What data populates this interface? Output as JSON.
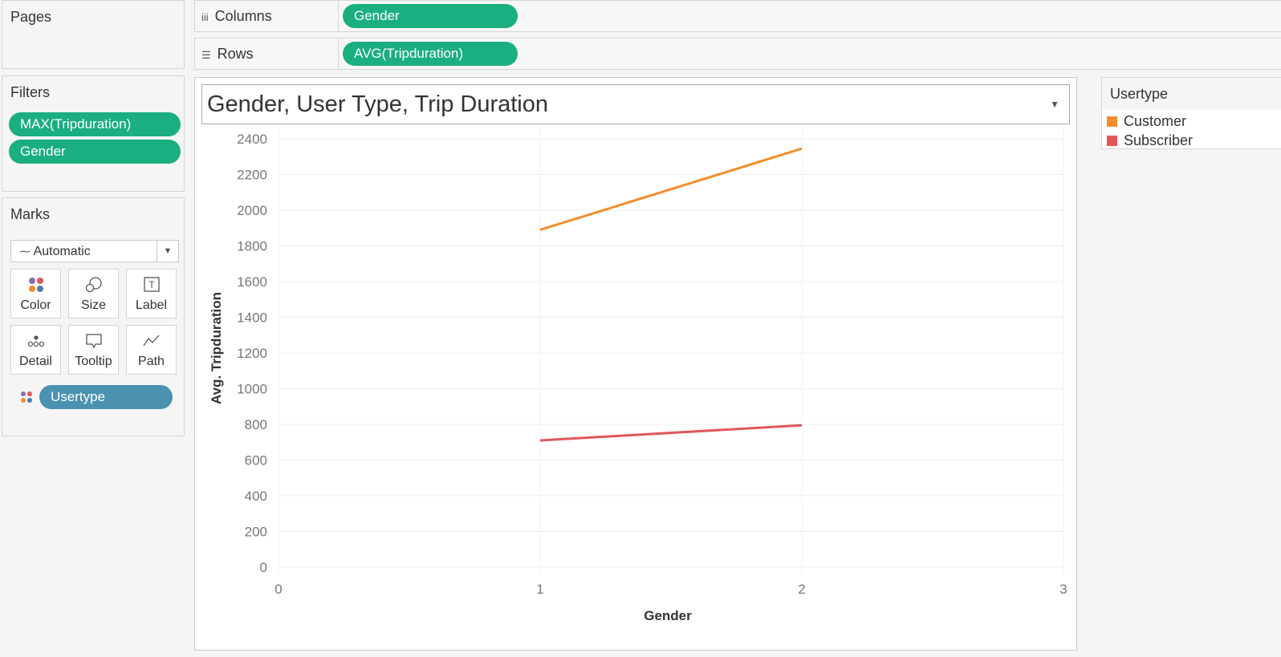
{
  "pages": {
    "title": "Pages"
  },
  "shelves": {
    "columns": {
      "label": "Columns",
      "pill": "Gender"
    },
    "rows": {
      "label": "Rows",
      "pill": "AVG(Tripduration)"
    }
  },
  "filters": {
    "title": "Filters",
    "pills": [
      "MAX(Tripduration)",
      "Gender"
    ]
  },
  "marks": {
    "title": "Marks",
    "type": "Automatic",
    "cards": {
      "color": "Color",
      "size": "Size",
      "label": "Label",
      "detail": "Detail",
      "tooltip": "Tooltip",
      "path": "Path"
    },
    "color_pill": "Usertype"
  },
  "viz": {
    "title": "Gender, User Type, Trip Duration"
  },
  "legend": {
    "title": "Usertype",
    "items": [
      {
        "label": "Customer",
        "color": "#f28e2b"
      },
      {
        "label": "Subscriber",
        "color": "#e15759"
      }
    ]
  },
  "chart_data": {
    "type": "line",
    "title": "Gender, User Type, Trip Duration",
    "xlabel": "Gender",
    "ylabel": "Avg. Tripduration",
    "xlim": [
      0,
      3
    ],
    "ylim": [
      0,
      2400
    ],
    "xticks": [
      0,
      1,
      2,
      3
    ],
    "yticks": [
      0,
      200,
      400,
      600,
      800,
      1000,
      1200,
      1400,
      1600,
      1800,
      2000,
      2200,
      2400
    ],
    "grid": true,
    "legend_position": "right",
    "series": [
      {
        "name": "Customer",
        "color": "#f28e2b",
        "x": [
          1,
          2
        ],
        "y": [
          1890,
          2345
        ]
      },
      {
        "name": "Subscriber",
        "color": "#e15759",
        "x": [
          1,
          2
        ],
        "y": [
          710,
          795
        ]
      }
    ]
  }
}
